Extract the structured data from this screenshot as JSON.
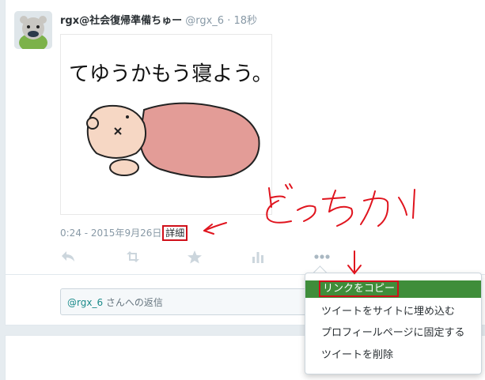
{
  "tweet": {
    "display_name": "rgx@社会復帰準備ちゅー",
    "handle": "@rgx_6",
    "dot": "·",
    "time": "18秒",
    "image_text": "てゆうかもう寝よう。",
    "timestamp": "0:24 - 2015年9月26日",
    "details_label": "詳細"
  },
  "actions": [
    "reply-icon",
    "retweet-icon",
    "favorite-icon",
    "analytics-icon",
    "more-icon"
  ],
  "reply": {
    "mention": "@rgx_6",
    "placeholder_rest": " さんへの返信"
  },
  "menu": {
    "items": [
      "リンクをコピー",
      "ツイートをサイトに埋め込む",
      "プロフィールページに固定する",
      "ツイートを削除"
    ]
  },
  "annotation": {
    "handwritten_text": "どっちか",
    "color": "#e0141e"
  },
  "colors": {
    "accent_green": "#3f8d3a",
    "muted": "#8899a6",
    "highlight_red": "#d0101a"
  }
}
